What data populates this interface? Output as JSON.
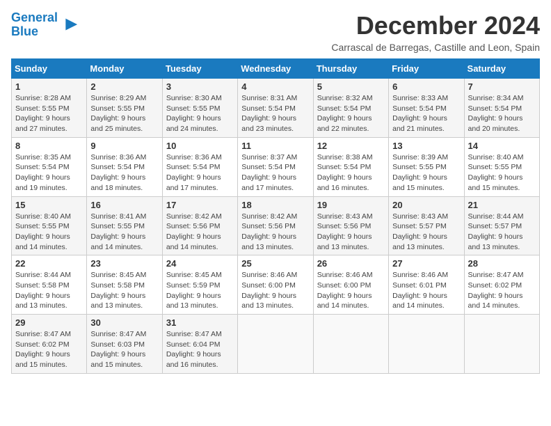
{
  "logo": {
    "line1": "General",
    "line2": "Blue"
  },
  "title": "December 2024",
  "location": "Carrascal de Barregas, Castille and Leon, Spain",
  "weekdays": [
    "Sunday",
    "Monday",
    "Tuesday",
    "Wednesday",
    "Thursday",
    "Friday",
    "Saturday"
  ],
  "weeks": [
    [
      {
        "day": 1,
        "info": "Sunrise: 8:28 AM\nSunset: 5:55 PM\nDaylight: 9 hours and 27 minutes."
      },
      {
        "day": 2,
        "info": "Sunrise: 8:29 AM\nSunset: 5:55 PM\nDaylight: 9 hours and 25 minutes."
      },
      {
        "day": 3,
        "info": "Sunrise: 8:30 AM\nSunset: 5:55 PM\nDaylight: 9 hours and 24 minutes."
      },
      {
        "day": 4,
        "info": "Sunrise: 8:31 AM\nSunset: 5:54 PM\nDaylight: 9 hours and 23 minutes."
      },
      {
        "day": 5,
        "info": "Sunrise: 8:32 AM\nSunset: 5:54 PM\nDaylight: 9 hours and 22 minutes."
      },
      {
        "day": 6,
        "info": "Sunrise: 8:33 AM\nSunset: 5:54 PM\nDaylight: 9 hours and 21 minutes."
      },
      {
        "day": 7,
        "info": "Sunrise: 8:34 AM\nSunset: 5:54 PM\nDaylight: 9 hours and 20 minutes."
      }
    ],
    [
      {
        "day": 8,
        "info": "Sunrise: 8:35 AM\nSunset: 5:54 PM\nDaylight: 9 hours and 19 minutes."
      },
      {
        "day": 9,
        "info": "Sunrise: 8:36 AM\nSunset: 5:54 PM\nDaylight: 9 hours and 18 minutes."
      },
      {
        "day": 10,
        "info": "Sunrise: 8:36 AM\nSunset: 5:54 PM\nDaylight: 9 hours and 17 minutes."
      },
      {
        "day": 11,
        "info": "Sunrise: 8:37 AM\nSunset: 5:54 PM\nDaylight: 9 hours and 17 minutes."
      },
      {
        "day": 12,
        "info": "Sunrise: 8:38 AM\nSunset: 5:54 PM\nDaylight: 9 hours and 16 minutes."
      },
      {
        "day": 13,
        "info": "Sunrise: 8:39 AM\nSunset: 5:55 PM\nDaylight: 9 hours and 15 minutes."
      },
      {
        "day": 14,
        "info": "Sunrise: 8:40 AM\nSunset: 5:55 PM\nDaylight: 9 hours and 15 minutes."
      }
    ],
    [
      {
        "day": 15,
        "info": "Sunrise: 8:40 AM\nSunset: 5:55 PM\nDaylight: 9 hours and 14 minutes."
      },
      {
        "day": 16,
        "info": "Sunrise: 8:41 AM\nSunset: 5:55 PM\nDaylight: 9 hours and 14 minutes."
      },
      {
        "day": 17,
        "info": "Sunrise: 8:42 AM\nSunset: 5:56 PM\nDaylight: 9 hours and 14 minutes."
      },
      {
        "day": 18,
        "info": "Sunrise: 8:42 AM\nSunset: 5:56 PM\nDaylight: 9 hours and 13 minutes."
      },
      {
        "day": 19,
        "info": "Sunrise: 8:43 AM\nSunset: 5:56 PM\nDaylight: 9 hours and 13 minutes."
      },
      {
        "day": 20,
        "info": "Sunrise: 8:43 AM\nSunset: 5:57 PM\nDaylight: 9 hours and 13 minutes."
      },
      {
        "day": 21,
        "info": "Sunrise: 8:44 AM\nSunset: 5:57 PM\nDaylight: 9 hours and 13 minutes."
      }
    ],
    [
      {
        "day": 22,
        "info": "Sunrise: 8:44 AM\nSunset: 5:58 PM\nDaylight: 9 hours and 13 minutes."
      },
      {
        "day": 23,
        "info": "Sunrise: 8:45 AM\nSunset: 5:58 PM\nDaylight: 9 hours and 13 minutes."
      },
      {
        "day": 24,
        "info": "Sunrise: 8:45 AM\nSunset: 5:59 PM\nDaylight: 9 hours and 13 minutes."
      },
      {
        "day": 25,
        "info": "Sunrise: 8:46 AM\nSunset: 6:00 PM\nDaylight: 9 hours and 13 minutes."
      },
      {
        "day": 26,
        "info": "Sunrise: 8:46 AM\nSunset: 6:00 PM\nDaylight: 9 hours and 14 minutes."
      },
      {
        "day": 27,
        "info": "Sunrise: 8:46 AM\nSunset: 6:01 PM\nDaylight: 9 hours and 14 minutes."
      },
      {
        "day": 28,
        "info": "Sunrise: 8:47 AM\nSunset: 6:02 PM\nDaylight: 9 hours and 14 minutes."
      }
    ],
    [
      {
        "day": 29,
        "info": "Sunrise: 8:47 AM\nSunset: 6:02 PM\nDaylight: 9 hours and 15 minutes."
      },
      {
        "day": 30,
        "info": "Sunrise: 8:47 AM\nSunset: 6:03 PM\nDaylight: 9 hours and 15 minutes."
      },
      {
        "day": 31,
        "info": "Sunrise: 8:47 AM\nSunset: 6:04 PM\nDaylight: 9 hours and 16 minutes."
      },
      null,
      null,
      null,
      null
    ]
  ]
}
